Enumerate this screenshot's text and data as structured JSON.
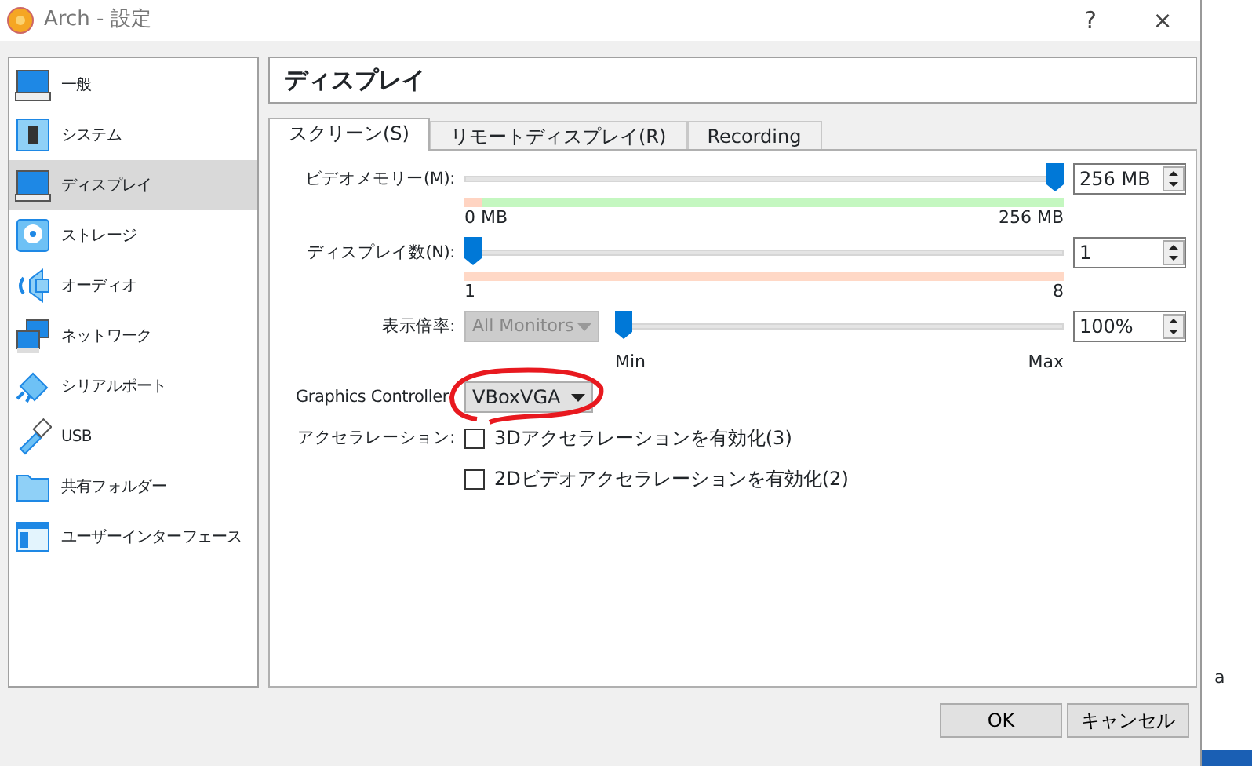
{
  "window": {
    "title": "Arch - 設定",
    "help": "?",
    "close": "×"
  },
  "sidebar": {
    "items": [
      {
        "label": "一般",
        "selected": false
      },
      {
        "label": "システム",
        "selected": false
      },
      {
        "label": "ディスプレイ",
        "selected": true
      },
      {
        "label": "ストレージ",
        "selected": false
      },
      {
        "label": "オーディオ",
        "selected": false
      },
      {
        "label": "ネットワーク",
        "selected": false
      },
      {
        "label": "シリアルポート",
        "selected": false
      },
      {
        "label": "USB",
        "selected": false
      },
      {
        "label": "共有フォルダー",
        "selected": false
      },
      {
        "label": "ユーザーインターフェース",
        "selected": false
      }
    ]
  },
  "page_title": "ディスプレイ",
  "tabs": [
    {
      "label": "スクリーン(S)",
      "selected": true
    },
    {
      "label": "リモートディスプレイ(R)",
      "selected": false
    },
    {
      "label": "Recording",
      "selected": false
    }
  ],
  "settings": [
    {
      "kind": "memory",
      "label": "ビデオメモリー(M):",
      "level": 1,
      "value": "256 MB",
      "min": "0 MB",
      "max": "256 MB"
    },
    {
      "kind": "count",
      "label": "ディスプレイ数(N):",
      "level": 0,
      "value": "1",
      "min": "1",
      "max": "8"
    },
    {
      "kind": "scale",
      "label": "表示倍率:",
      "combo": "All Monitors",
      "combo_disabled": true,
      "level": 0,
      "value": "100%",
      "min": "Min",
      "max": "Max"
    },
    {
      "kind": "combo",
      "label": "Graphics Controller",
      "value": "VBoxVGA",
      "circled": true
    },
    {
      "kind": "checkbox",
      "label": "アクセラレーション:",
      "text": "3Dアクセラレーションを有効化(3)",
      "checked": false
    },
    {
      "kind": "checkbox",
      "text": "2Dビデオアクセラレーションを有効化(2)",
      "checked": false
    }
  ],
  "buttons": [
    "OK",
    "キャンセル"
  ],
  "background_window": {
    "text": "a"
  }
}
